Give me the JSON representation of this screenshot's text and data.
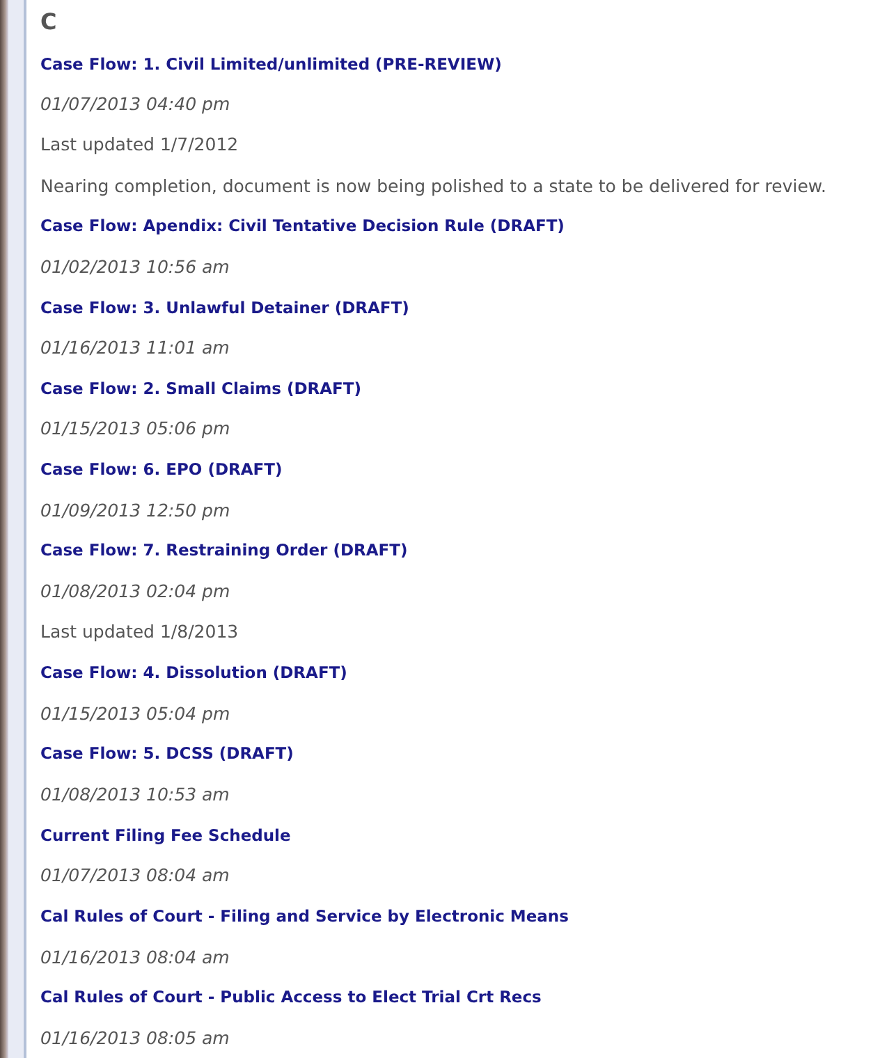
{
  "section": {
    "letter": "C"
  },
  "items": [
    {
      "title": "Case Flow: 1. Civil Limited/unlimited (PRE-REVIEW)",
      "date": "01/07/2013 04:40 pm",
      "notes": [
        "Last updated 1/7/2012",
        "Nearing completion, document is now being polished to a state to be delivered for review."
      ]
    },
    {
      "title": "Case Flow: Apendix: Civil Tentative Decision Rule (DRAFT)",
      "date": "01/02/2013 10:56 am"
    },
    {
      "title": "Case Flow: 3. Unlawful Detainer (DRAFT)",
      "date": "01/16/2013 11:01 am"
    },
    {
      "title": "Case Flow: 2. Small Claims (DRAFT)",
      "date": "01/15/2013 05:06 pm"
    },
    {
      "title": "Case Flow: 6. EPO (DRAFT)",
      "date": "01/09/2013 12:50 pm"
    },
    {
      "title": "Case Flow: 7. Restraining Order (DRAFT)",
      "date": "01/08/2013 02:04 pm",
      "notes": [
        "Last updated 1/8/2013"
      ]
    },
    {
      "title": "Case Flow: 4. Dissolution (DRAFT)",
      "date": "01/15/2013 05:04 pm"
    },
    {
      "title": "Case Flow: 5. DCSS (DRAFT)",
      "date": "01/08/2013 10:53 am"
    },
    {
      "title": "Current Filing Fee Schedule",
      "date": "01/07/2013 08:04 am"
    },
    {
      "title": "Cal Rules of Court - Filing and Service by Electronic Means",
      "date": "01/16/2013 08:04 am"
    },
    {
      "title": "Cal Rules of Court - Public Access to Elect Trial Crt Recs",
      "date": "01/16/2013 08:05 am"
    }
  ]
}
